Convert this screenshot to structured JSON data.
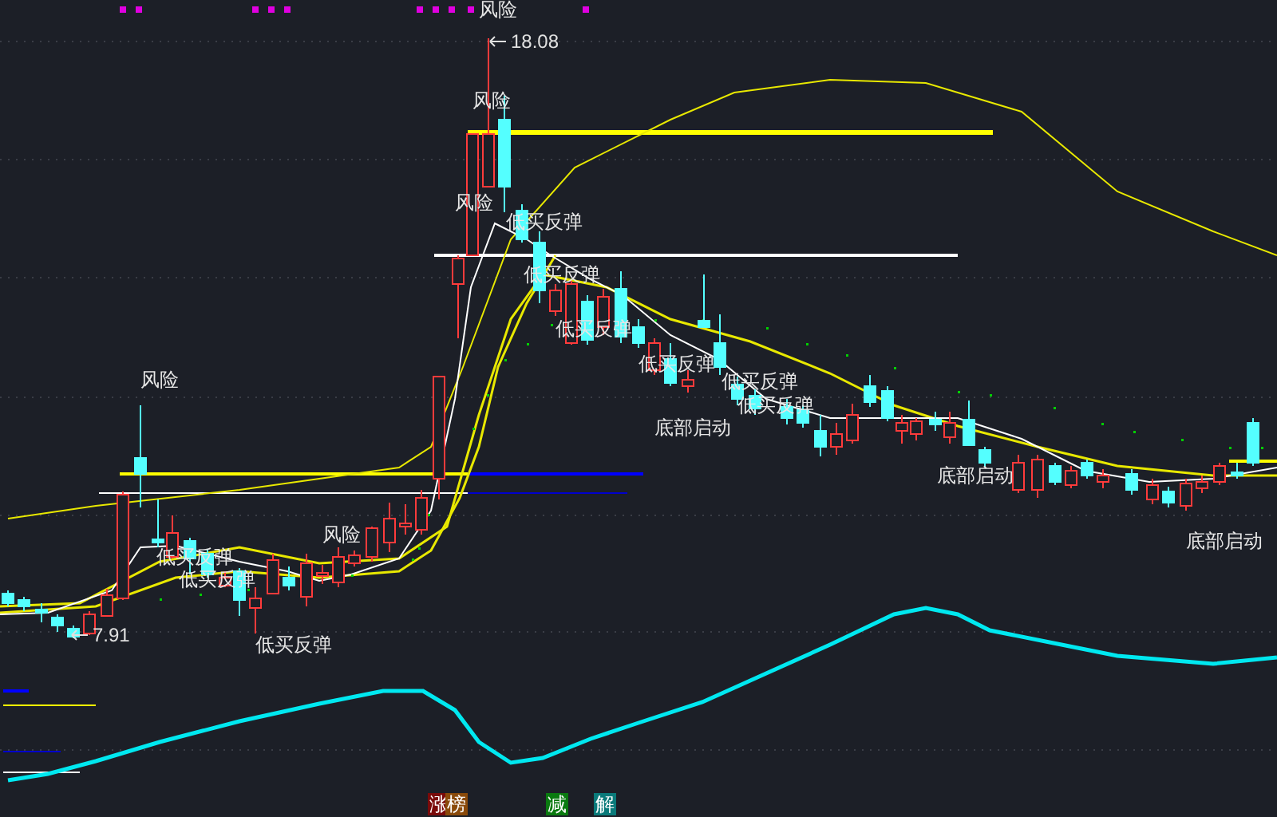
{
  "annotations": [
    {
      "kind": "signal",
      "text": "风险"
    },
    {
      "kind": "price",
      "text": "18.08"
    },
    {
      "kind": "signal",
      "text": "风险"
    },
    {
      "kind": "signal",
      "text": "风险"
    },
    {
      "kind": "signal",
      "text": "低买反弹"
    },
    {
      "kind": "signal",
      "text": "低买反弹"
    },
    {
      "kind": "signal",
      "text": "低买反弹"
    },
    {
      "kind": "signal",
      "text": "低买反弹"
    },
    {
      "kind": "signal",
      "text": "低买反弹"
    },
    {
      "kind": "signal",
      "text": "低买反弹"
    },
    {
      "kind": "signal",
      "text": "底部启动"
    },
    {
      "kind": "signal",
      "text": "底部启动"
    },
    {
      "kind": "signal",
      "text": "底部启动"
    },
    {
      "kind": "signal",
      "text": "风险"
    },
    {
      "kind": "signal",
      "text": "低买反弹"
    },
    {
      "kind": "signal",
      "text": "低买反弹"
    },
    {
      "kind": "signal",
      "text": "风险"
    },
    {
      "kind": "signal",
      "text": "低买反弹"
    },
    {
      "kind": "price",
      "text": "7.91"
    }
  ],
  "badges": [
    {
      "text": "涨",
      "color": "#7a0a0a"
    },
    {
      "text": "榜",
      "color": "#8a4a0a"
    },
    {
      "text": "减",
      "color": "#0a7a10"
    },
    {
      "text": "解",
      "color": "#0a7a7a"
    }
  ]
}
